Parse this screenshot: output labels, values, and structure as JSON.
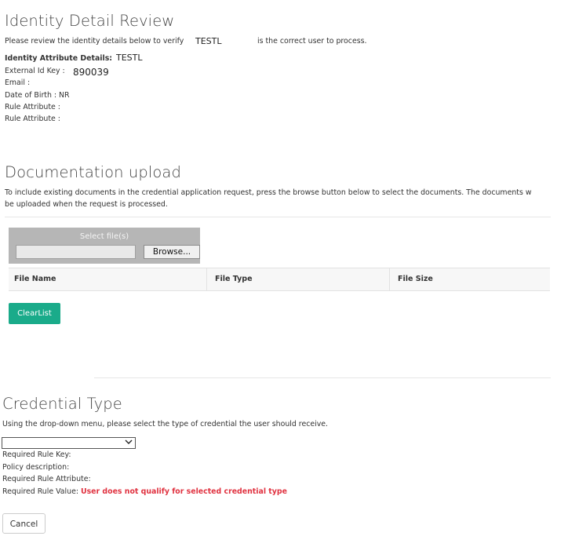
{
  "identity": {
    "title": "Identity Detail Review",
    "intro_prefix": "Please review the identity details below to verify",
    "intro_user": "TESTL",
    "intro_suffix": "is the correct user to process.",
    "details_label": "Identity Attribute Details:",
    "details_value": "TESTL",
    "external_id_label": "External Id Key :",
    "external_id_value": "890039",
    "email_label": "Email :",
    "dob_label": "Date of Birth : NR",
    "rule_attr_1": "Rule Attribute :",
    "rule_attr_2": "Rule Attribute :"
  },
  "upload": {
    "title": "Documentation upload",
    "description_line1": "To include existing documents in the credential application request, press the browse button below to select the documents. The documents w",
    "description_line2": "be uploaded when the request is processed.",
    "select_label": "Select file(s)",
    "browse_label": "Browse...",
    "columns": [
      "File Name",
      "File Type",
      "File Size"
    ],
    "clear_label": "ClearList"
  },
  "credential": {
    "title": "Credential Type",
    "description": "Using the drop-down menu, please select the type of credential the user should receive.",
    "select_value": "",
    "required_rule_key": "Required Rule Key:",
    "policy_description": "Policy description:",
    "required_rule_attribute": "Required Rule Attribute:",
    "required_rule_value_label": "Required Rule Value:",
    "required_rule_value_error": "User does not qualify for selected credential type",
    "error_color": "#e0313f"
  },
  "actions": {
    "cancel_label": "Cancel"
  },
  "colors": {
    "accent": "#1aab8a",
    "dropzone": "#b6b6b6"
  }
}
